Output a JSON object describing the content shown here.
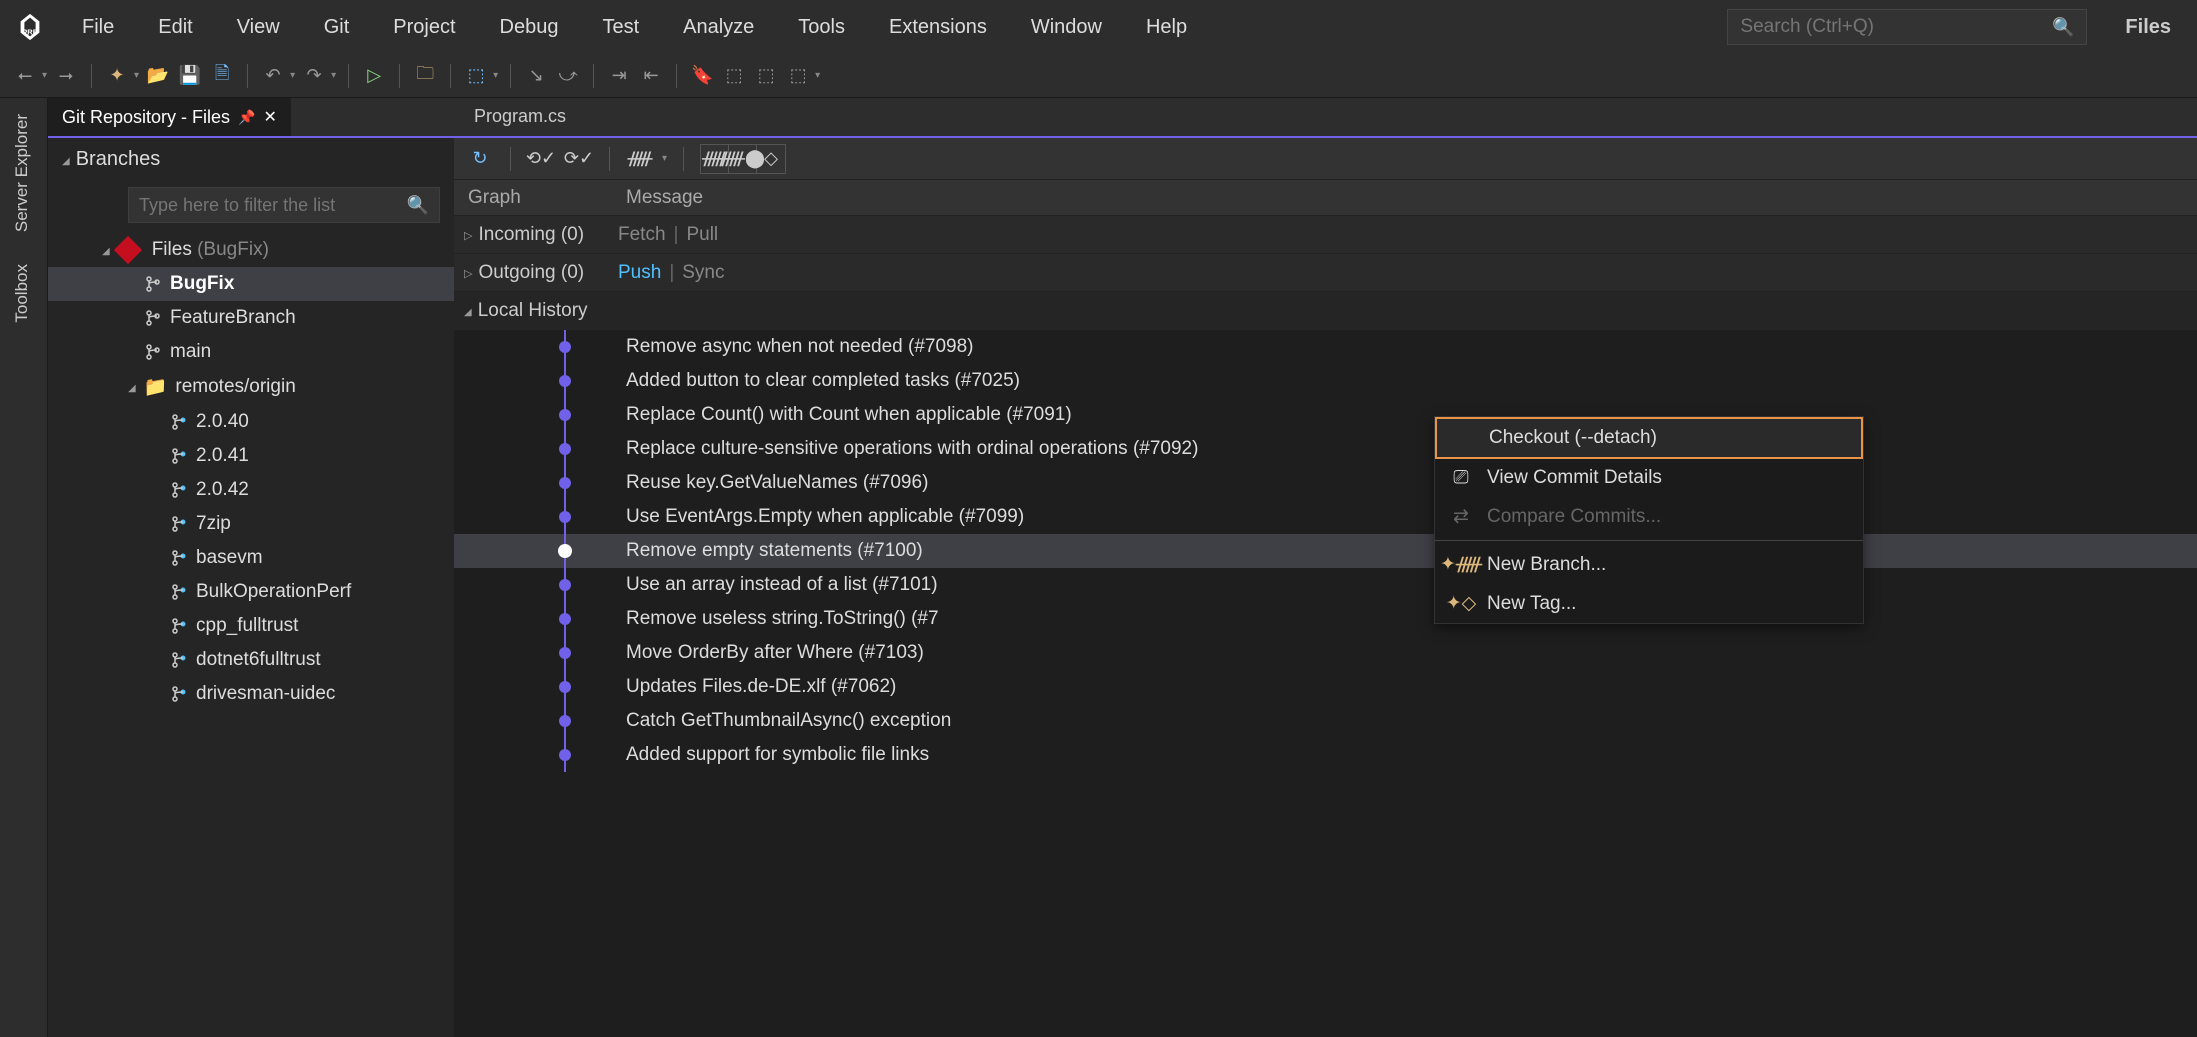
{
  "menu": [
    "File",
    "Edit",
    "View",
    "Git",
    "Project",
    "Debug",
    "Test",
    "Analyze",
    "Tools",
    "Extensions",
    "Window",
    "Help"
  ],
  "search_placeholder": "Search (Ctrl+Q)",
  "files_btn": "Files",
  "side_tabs": [
    "Server Explorer",
    "Toolbox"
  ],
  "left_tab": "Git Repository - Files",
  "right_tab": "Program.cs",
  "branches_label": "Branches",
  "filter_placeholder": "Type here to filter the list",
  "repo_name": "Files",
  "repo_branch": "(BugFix)",
  "current_branch": "BugFix",
  "local_branches": [
    "FeatureBranch",
    "main"
  ],
  "remotes_label": "remotes/origin",
  "remote_branches": [
    "2.0.40",
    "2.0.41",
    "2.0.42",
    "7zip",
    "basevm",
    "BulkOperationPerf",
    "cpp_fulltrust",
    "dotnet6fulltrust",
    "drivesman-uidec"
  ],
  "col_graph": "Graph",
  "col_msg": "Message",
  "incoming": {
    "label": "Incoming (0)",
    "a1": "Fetch",
    "a2": "Pull"
  },
  "outgoing": {
    "label": "Outgoing (0)",
    "a1": "Push",
    "a2": "Sync"
  },
  "history_label": "Local History",
  "commits": [
    "Remove async when not needed (#7098)",
    "Added button to clear completed tasks (#7025)",
    "Replace Count() with Count when applicable (#7091)",
    "Replace culture-sensitive operations with ordinal operations (#7092)",
    "Reuse key.GetValueNames (#7096)",
    "Use EventArgs.Empty when applicable (#7099)",
    "Remove empty statements (#7100)",
    "Use an array instead of a list (#7101)",
    "Remove useless string.ToString() (#7",
    "Move OrderBy after Where (#7103)",
    "Updates Files.de-DE.xlf (#7062)",
    "Catch GetThumbnailAsync() exception",
    "Added support for symbolic file links"
  ],
  "selected_commit_index": 6,
  "ctx": {
    "checkout": "Checkout (--detach)",
    "view": "View Commit Details",
    "compare": "Compare Commits...",
    "newbranch": "New Branch...",
    "newtag": "New Tag..."
  }
}
